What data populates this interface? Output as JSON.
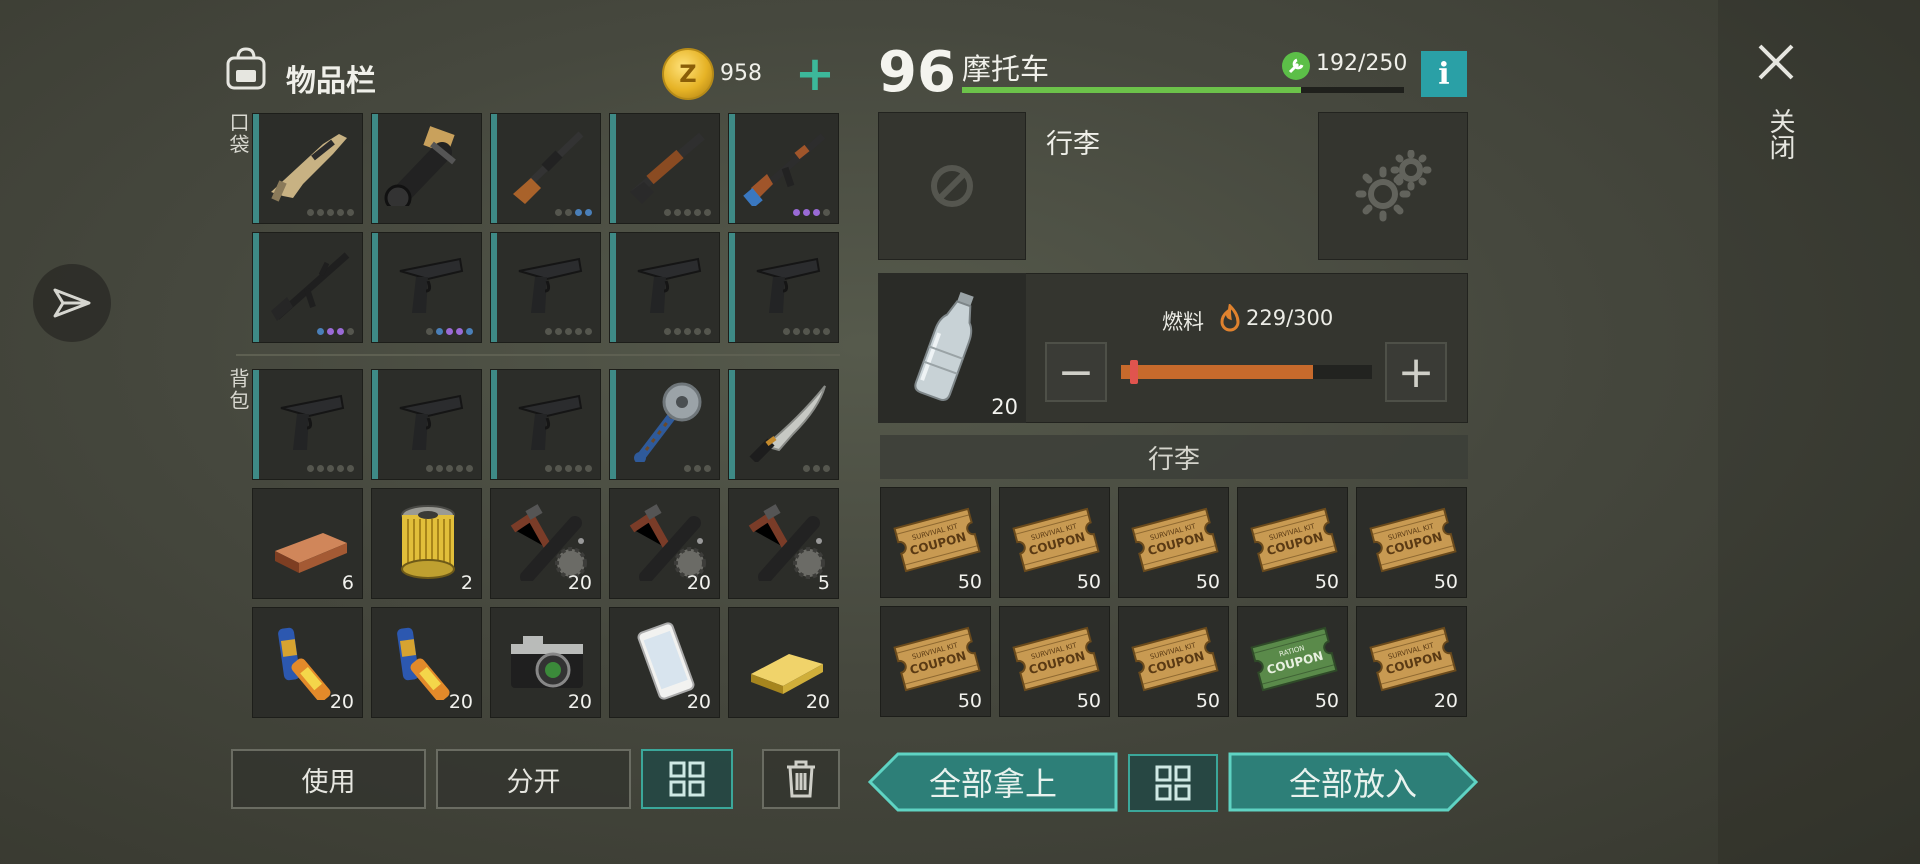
{
  "inventory": {
    "title": "物品栏",
    "currency": {
      "amount": "958"
    },
    "pocket_label": "口袋",
    "backpack_label": "背包",
    "pocket_slots": [
      {
        "icon": "scar-rifle-icon",
        "dots": [
          "grey",
          "grey",
          "grey",
          "grey",
          "grey"
        ]
      },
      {
        "icon": "minigun-icon",
        "dots": []
      },
      {
        "icon": "hunting-rifle-icon",
        "dots": [
          "grey",
          "grey",
          "blue",
          "blue"
        ]
      },
      {
        "icon": "shotgun-icon",
        "dots": [
          "grey",
          "grey",
          "grey",
          "grey",
          "grey"
        ]
      },
      {
        "icon": "ak47-icon",
        "dots": [
          "purple",
          "purple",
          "purple",
          "grey"
        ]
      },
      {
        "icon": "m16-rifle-icon",
        "dots": [
          "blue",
          "purple",
          "purple",
          "grey"
        ]
      },
      {
        "icon": "pistol-icon",
        "dots": [
          "grey",
          "blue",
          "purple",
          "purple",
          "blue"
        ]
      },
      {
        "icon": "pistol-icon",
        "dots": [
          "grey",
          "grey",
          "grey",
          "grey",
          "grey"
        ]
      },
      {
        "icon": "pistol-icon",
        "dots": [
          "grey",
          "grey",
          "grey",
          "grey",
          "grey"
        ]
      },
      {
        "icon": "pistol-icon",
        "dots": [
          "grey",
          "grey",
          "grey",
          "grey",
          "grey"
        ]
      }
    ],
    "backpack_slots": [
      {
        "icon": "pistol-icon",
        "dots": [
          "grey",
          "grey",
          "grey",
          "grey",
          "grey"
        ]
      },
      {
        "icon": "pistol-icon",
        "dots": [
          "grey",
          "grey",
          "grey",
          "grey",
          "grey"
        ]
      },
      {
        "icon": "pistol-icon",
        "dots": [
          "grey",
          "grey",
          "grey",
          "grey",
          "grey"
        ]
      },
      {
        "icon": "sawblade-mace-icon",
        "dots": [
          "grey",
          "grey",
          "grey"
        ]
      },
      {
        "icon": "machete-icon",
        "dots": [
          "grey",
          "grey",
          "grey"
        ]
      },
      {
        "icon": "copper-ingot-icon",
        "qty": "6"
      },
      {
        "icon": "oil-filter-icon",
        "qty": "2"
      },
      {
        "icon": "parts-kit-icon",
        "qty": "20"
      },
      {
        "icon": "parts-kit-icon",
        "qty": "20"
      },
      {
        "icon": "parts-kit-icon",
        "qty": "5"
      },
      {
        "icon": "batteries-icon",
        "qty": "20"
      },
      {
        "icon": "batteries-icon",
        "qty": "20"
      },
      {
        "icon": "camera-icon",
        "qty": "20"
      },
      {
        "icon": "smartphone-icon",
        "qty": "20"
      },
      {
        "icon": "gold-bar-icon",
        "qty": "20"
      }
    ],
    "buttons": {
      "use": "使用",
      "split": "分开"
    }
  },
  "vehicle": {
    "level": "96",
    "name": "摩托车",
    "durability": "192/250",
    "durability_ratio": 0.768,
    "info_label": "i",
    "luggage_title": "行李",
    "fuel": {
      "label": "燃料",
      "value": "229/300",
      "ratio": 0.7633,
      "bottle_qty": "20"
    },
    "luggage_header": "行李",
    "luggage_slots": [
      {
        "icon": "survival-kit-coupon-icon",
        "qty": "50",
        "text_top": "SURVIVAL KIT",
        "text_main": "COUPON"
      },
      {
        "icon": "survival-kit-coupon-icon",
        "qty": "50",
        "text_top": "SURVIVAL KIT",
        "text_main": "COUPON"
      },
      {
        "icon": "survival-kit-coupon-icon",
        "qty": "50",
        "text_top": "SURVIVAL KIT",
        "text_main": "COUPON"
      },
      {
        "icon": "survival-kit-coupon-icon",
        "qty": "50",
        "text_top": "SURVIVAL KIT",
        "text_main": "COUPON"
      },
      {
        "icon": "survival-kit-coupon-icon",
        "qty": "50",
        "text_top": "SURVIVAL KIT",
        "text_main": "COUPON"
      },
      {
        "icon": "survival-kit-coupon-icon",
        "qty": "50",
        "text_top": "SURVIVAL KIT",
        "text_main": "COUPON"
      },
      {
        "icon": "survival-kit-coupon-icon",
        "qty": "50",
        "text_top": "SURVIVAL KIT",
        "text_main": "COUPON"
      },
      {
        "icon": "survival-kit-coupon-icon",
        "qty": "50",
        "text_top": "SURVIVAL KIT",
        "text_main": "COUPON"
      },
      {
        "icon": "ration-coupon-icon",
        "qty": "50",
        "text_top": "RATION",
        "text_main": "COUPON"
      },
      {
        "icon": "survival-kit-coupon-icon",
        "qty": "20",
        "text_top": "SURVIVAL KIT",
        "text_main": "COUPON"
      }
    ],
    "buttons": {
      "take_all": "全部拿上",
      "put_all": "全部放入"
    }
  },
  "close_label": "关闭",
  "colors": {
    "accent_teal": "#3ba79a",
    "durability_green": "#6cc24a",
    "fuel_orange": "#c76a2c",
    "info_blue": "#2aa0a6",
    "coin_gold": "#e6b326"
  }
}
